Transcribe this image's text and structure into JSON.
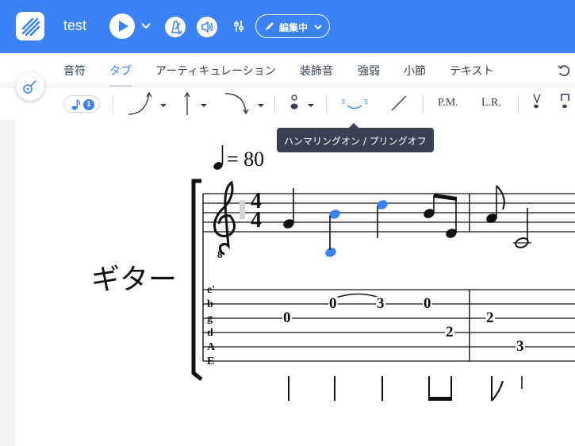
{
  "header": {
    "title": "test",
    "edit_mode_label": "編集中",
    "brand_color": "#3b82f6"
  },
  "tabs": [
    {
      "label": "音符",
      "active": false
    },
    {
      "label": "タブ",
      "active": true
    },
    {
      "label": "アーティキュレーション",
      "active": false
    },
    {
      "label": "装飾音",
      "active": false
    },
    {
      "label": "強弱",
      "active": false
    },
    {
      "label": "小節",
      "active": false
    },
    {
      "label": "テキスト",
      "active": false
    }
  ],
  "toolbar": {
    "selected_count": "1",
    "hammer_label_from": "3",
    "hammer_label_to": "5",
    "palm_mute_label": "P.M.",
    "let_ring_label": "L.R.",
    "tooltip": "ハンマリングオン / プリングオフ"
  },
  "score": {
    "instrument": "ギター",
    "tempo": "= 80",
    "time_signature": {
      "top": "4",
      "bottom": "4"
    },
    "clef_octave": "8",
    "string_names": [
      "e'",
      "b",
      "g",
      "d",
      "A",
      "E"
    ],
    "tab_numbers": [
      {
        "fret": "0",
        "string": "g"
      },
      {
        "fret": "0",
        "string": "b"
      },
      {
        "fret": "3",
        "string": "b"
      },
      {
        "fret": "0",
        "string": "b"
      },
      {
        "fret": "2",
        "string": "d"
      },
      {
        "fret": "2",
        "string": "g"
      },
      {
        "fret": "3",
        "string": "A"
      }
    ],
    "selected_note_color": "#3b82f6"
  },
  "icons": [
    "app-logo-icon",
    "play-icon",
    "chevron-down-icon",
    "metronome-icon",
    "speaker-icon",
    "mixer-icon",
    "pencil-icon",
    "guitar-icon",
    "undo-icon",
    "note-icon",
    "bend-icon",
    "vibrato-icon",
    "release-icon",
    "harmonic-icon",
    "hammer-on-icon",
    "slide-icon",
    "pick-up-icon",
    "pick-down-icon"
  ]
}
